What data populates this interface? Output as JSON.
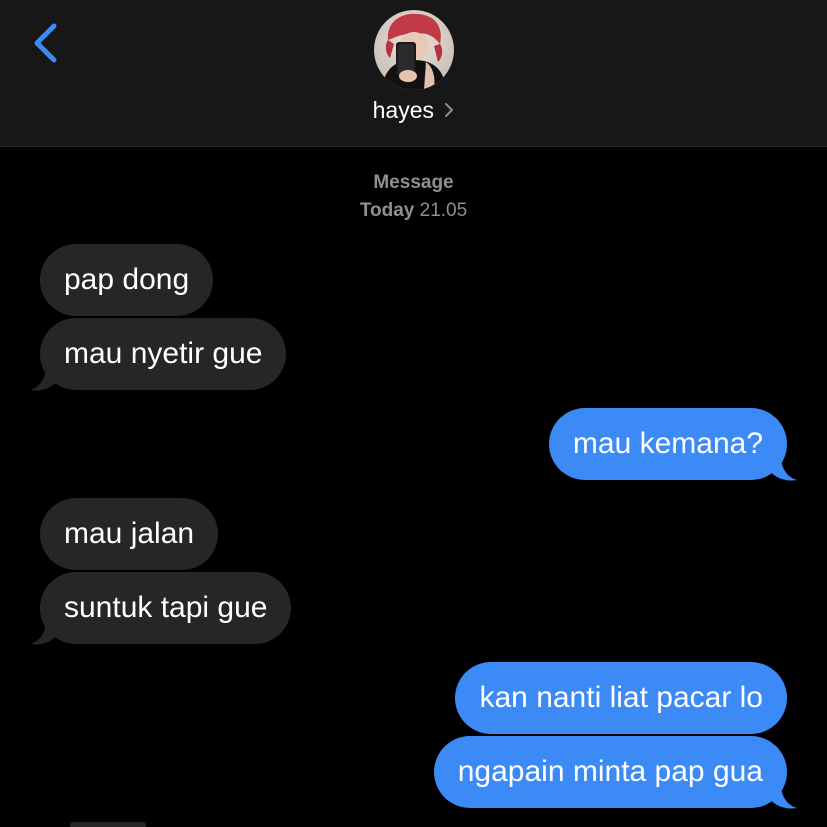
{
  "header": {
    "back_icon": "chevron-left-icon",
    "contact_name": "hayes",
    "chevron": "›"
  },
  "meta": {
    "service": "Message",
    "day": "Today",
    "time": "21.05"
  },
  "messages": [
    {
      "direction": "received",
      "text": "pap dong"
    },
    {
      "direction": "received",
      "text": "mau nyetir gue"
    },
    {
      "direction": "sent",
      "text": "mau kemana?"
    },
    {
      "direction": "received",
      "text": "mau jalan"
    },
    {
      "direction": "received",
      "text": "suntuk tapi gue"
    },
    {
      "direction": "sent",
      "text": "kan nanti liat pacar lo"
    },
    {
      "direction": "sent",
      "text": "ngapain minta pap gua"
    }
  ],
  "colors": {
    "background": "#000000",
    "header": "#171717",
    "received_bubble": "#262628",
    "sent_bubble": "#3b8af6",
    "accent": "#3b8af6",
    "meta_text": "#8e8e93"
  }
}
